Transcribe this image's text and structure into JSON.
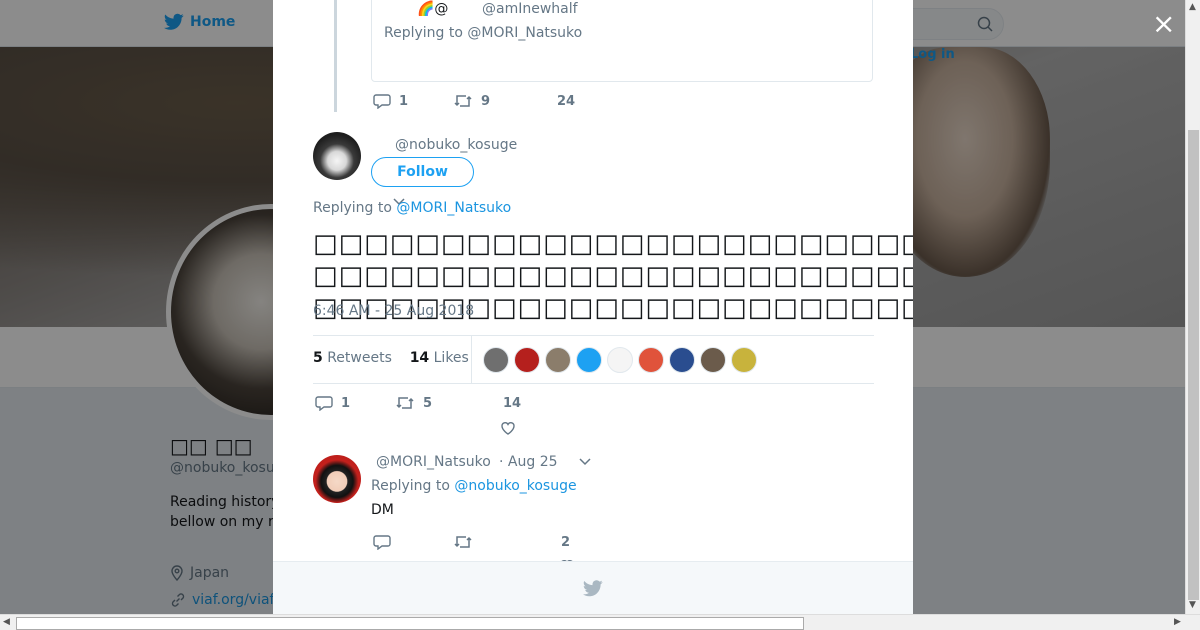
{
  "background": {
    "nav": {
      "home_label": "Home",
      "login_label": "Log in"
    },
    "profile": {
      "name": "□□ □□",
      "handle": "@nobuko_kosu",
      "bio": "Reading history bellow on my r",
      "location": "Japan",
      "url": "viaf.org/viaf"
    }
  },
  "modal": {
    "close_label": "×",
    "quoted": {
      "emoji": "🌈@",
      "handle": "@amInewhalf",
      "replying_prefix": "Replying to",
      "replying_to": "@MORI_Natsuko"
    },
    "parent_actions": {
      "replies": "1",
      "retweets": "9",
      "likes": "24"
    },
    "main_tweet": {
      "handle": "@nobuko_kosuge",
      "follow_label": "Follow",
      "replying_prefix": "Replying to",
      "replying_to": "@MORI_Natsuko",
      "text": "□□□□□□□□□□□□□□□□□□□□□□□□□□□□□□□□□□□□□□□□□□□□□□□□□□□□□□□□□□□□□□□□□□□□□□□□□□□□□□□□□□□□□□□□□□□□□□□□□□□□",
      "timestamp": "6:46 AM - 25 Aug 2018",
      "retweets_count": "5",
      "retweets_label": "Retweets",
      "likes_count": "14",
      "likes_label": "Likes",
      "likers_colors": [
        "#6f6f6f",
        "#b5201d",
        "#8b7d6b",
        "#1da1f2",
        "#f5f5f5",
        "#e0533b",
        "#2a4d8f",
        "#6b5b4b",
        "#c8b33c"
      ],
      "actions": {
        "replies": "1",
        "retweets": "5",
        "likes": "14"
      }
    },
    "reply": {
      "handle": "@MORI_Natsuko",
      "date": "· Aug 25",
      "replying_prefix": "Replying to",
      "replying_to": "@nobuko_kosuge",
      "text": "DM",
      "actions": {
        "likes": "2"
      }
    }
  },
  "colors": {
    "accent": "#1da1f2",
    "link": "#1b95e0",
    "muted": "#657786"
  }
}
